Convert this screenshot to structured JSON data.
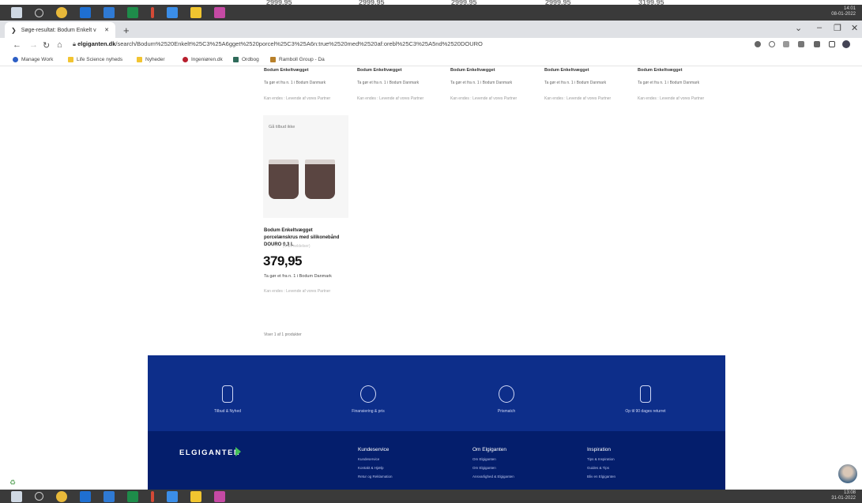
{
  "top_prices": [
    "2999,95",
    "2999,95",
    "2999,95",
    "2999,95",
    "3199,95"
  ],
  "taskbar": {
    "clock_top": [
      "14:01",
      "08-01-2022"
    ],
    "clock_bottom": [
      "13:08",
      "31-01-2022"
    ]
  },
  "browser": {
    "tab_title": "Søge-resultat: Bodum Enkelt v",
    "url_domain": "elgiganten.dk",
    "url_path": "/search/Bodum%2520Enkelt%25C3%25A6gget%2520porcel%25C3%25A6n:true%2520med%2520af:orebl%25C3%25A5nd%2520DOURO",
    "bookmarks": [
      "Manage Work",
      "Life Science nyheds",
      "Nyheder",
      "Ingeniøren.dk",
      "Ordbog",
      "Ramboll Group - Da"
    ]
  },
  "product_row": [
    {
      "title": "Bodum Enkeltvægget",
      "line1": "Ta gør et fra n. 1 i Bodum Danmark",
      "line2": "Kan endes : Levende af vores Partner"
    },
    {
      "title": "Bodum Enkeltvægget",
      "line1": "Ta gør et fra n. 1 i Bodum Danmark",
      "line2": "Kan endes : Levende af vores Partner"
    },
    {
      "title": "Bodum Enkeltvægget",
      "line1": "Ta gør et fra n. 1 i Bodum Danmark",
      "line2": "Kan endes : Levende af vores Partner"
    },
    {
      "title": "Bodum Enkeltvægget",
      "line1": "Ta gør et fra n. 1 i Bodum Danmark",
      "line2": "Kan endes : Levende af vores Partner"
    },
    {
      "title": "Bodum Enkeltvægget",
      "line1": "Ta gør et fra n. 1 i Bodum Danmark",
      "line2": "Kan endes : Levende af vores Partner"
    }
  ],
  "product": {
    "badge": "Gå tilbud ikke",
    "name": "Bodum Enkeltvægget porcelænskrus med silikonebånd DOURO 0,3 L",
    "rating": "☆☆☆☆☆ (0 anmeldelser)",
    "price": "379,95",
    "stock": "Ta gør et fra n. 1 i Bodum Danmark",
    "store": "Kan endes : Levende af vores Partner"
  },
  "results_count": "Viser 1 af 1 produkter",
  "footer": {
    "features": [
      "Tilbud & Nyhed",
      "Finansiering & pris",
      "Prismatch",
      "Op til 90 dages returret"
    ],
    "logo": "ELGIGANTEN",
    "columns": [
      {
        "heading": "Kundeservice",
        "items": [
          "Kundeservice",
          "Kontakt & Hjælp",
          "Retur og Reklamation"
        ]
      },
      {
        "heading": "Om Elgiganten",
        "items": [
          "Om Elgiganten",
          "Om Elgiganten",
          "Ansvarlighed & Elgiganten"
        ]
      },
      {
        "heading": "Inspiration",
        "items": [
          "Tips & Inspiration",
          "Guides & Tips",
          "Bliv en Elgiganten"
        ]
      }
    ]
  },
  "colors": {
    "footer_bg": "#041e6c",
    "footer_top": "#0d2e8a",
    "logo_arrow": "#44c25a",
    "cup": "#5a4541"
  }
}
